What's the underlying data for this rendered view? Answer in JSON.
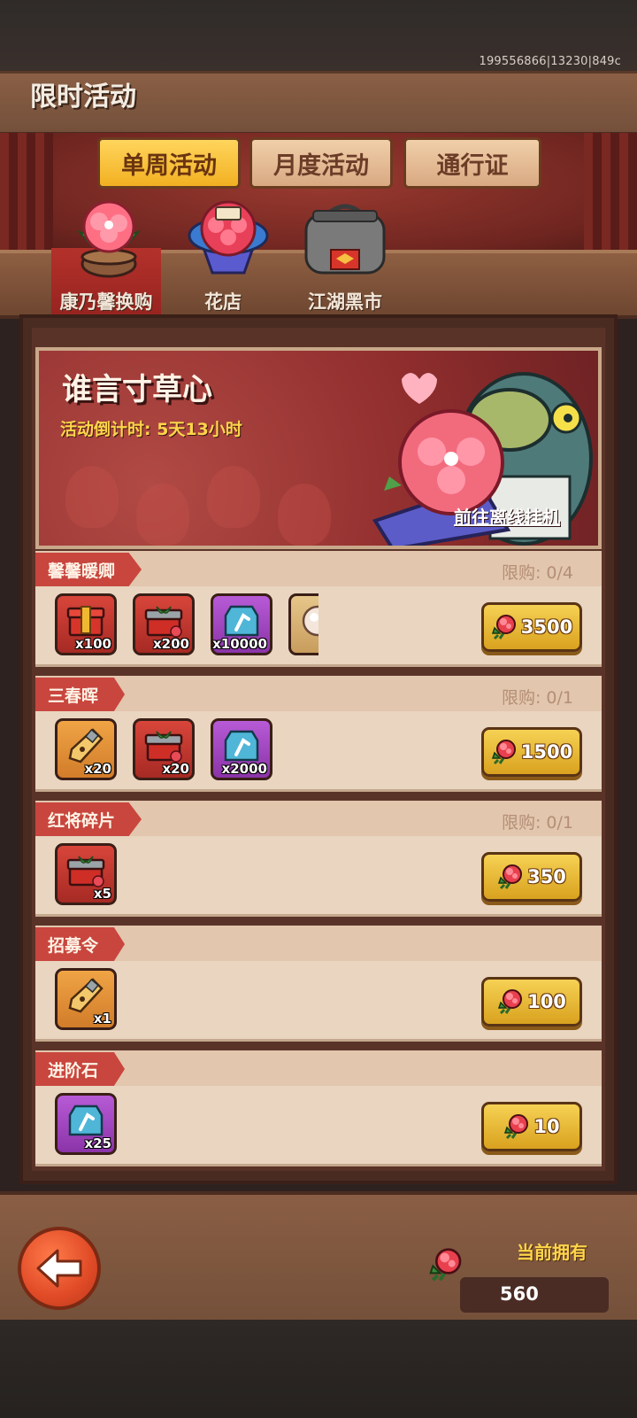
{
  "build_id": "199556866|13230|849c",
  "page_title": "限时活动",
  "tabs": [
    {
      "label": "单周活动",
      "active": true
    },
    {
      "label": "月度活动",
      "active": false
    },
    {
      "label": "通行证",
      "active": false
    }
  ],
  "subtabs": [
    {
      "label": "康乃馨换购",
      "icon": "carnation-pot-icon",
      "active": true
    },
    {
      "label": "花店",
      "icon": "flower-bouquet-icon",
      "active": false
    },
    {
      "label": "江湖黑市",
      "icon": "black-market-bag-icon",
      "active": false
    }
  ],
  "banner": {
    "title": "谁言寸草心",
    "timer": "活动倒计时: 5天13小时",
    "link": "前往离线挂机"
  },
  "rows": [
    {
      "name": "馨馨暖卿",
      "limit": "限购: 0/4",
      "price": "3500",
      "items": [
        {
          "icon": "red-gold-chest-icon",
          "qty": "x100",
          "color": "red"
        },
        {
          "icon": "red-gift-box-icon",
          "qty": "x200",
          "color": "red"
        },
        {
          "icon": "advance-stone-icon",
          "qty": "x10000",
          "color": "purple"
        },
        {
          "icon": "pearl-icon",
          "qty": "",
          "color": "beige"
        }
      ]
    },
    {
      "name": "三春晖",
      "limit": "限购: 0/1",
      "price": "1500",
      "items": [
        {
          "icon": "recruit-token-icon",
          "qty": "x20",
          "color": "orange"
        },
        {
          "icon": "red-gift-box-icon",
          "qty": "x20",
          "color": "red"
        },
        {
          "icon": "advance-stone-icon",
          "qty": "x2000",
          "color": "purple"
        }
      ]
    },
    {
      "name": "红将碎片",
      "limit": "限购: 0/1",
      "price": "350",
      "items": [
        {
          "icon": "red-gift-box-icon",
          "qty": "x5",
          "color": "red"
        }
      ]
    },
    {
      "name": "招募令",
      "limit": "",
      "price": "100",
      "items": [
        {
          "icon": "recruit-token-icon",
          "qty": "x1",
          "color": "orange"
        }
      ]
    },
    {
      "name": "进阶石",
      "limit": "",
      "price": "10",
      "items": [
        {
          "icon": "advance-stone-icon",
          "qty": "x25",
          "color": "purple"
        }
      ]
    }
  ],
  "footer": {
    "own_label": "当前拥有",
    "own_value": "560",
    "currency_icon": "carnation-icon"
  },
  "colors": {
    "tab_active": "#f2b022",
    "tag_red": "#c8463e",
    "price_gold": "#d9a21f",
    "back_orange": "#e04a26"
  }
}
